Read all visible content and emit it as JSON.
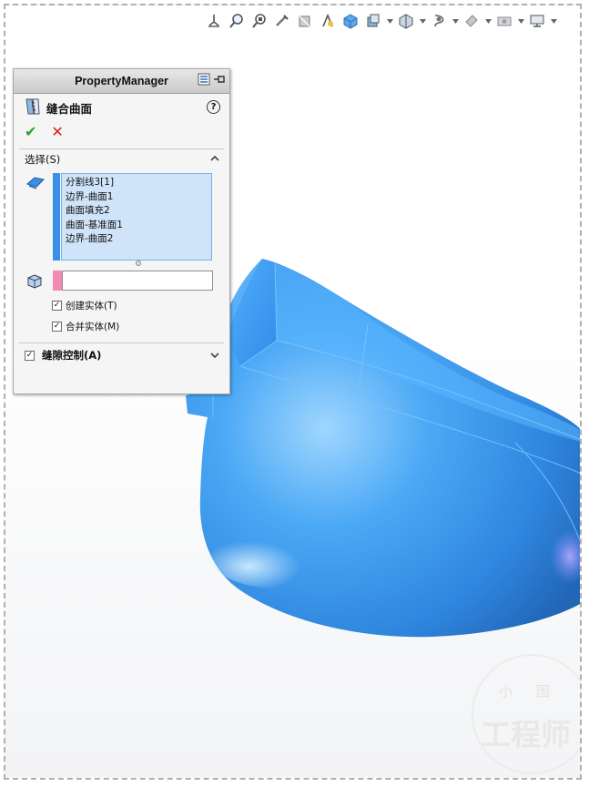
{
  "toolbar": {
    "icons": [
      "view-orientation-icon",
      "zoom-to-fit-icon",
      "zoom-area-icon",
      "previous-view-icon",
      "section-view-icon",
      "dynamic-annotation-icon",
      "view-orientation-cube-icon",
      "display-style-icon",
      "hide-show-icon",
      "edit-appearance-icon",
      "apply-scene-icon",
      "view-settings-icon",
      "monitor-icon"
    ]
  },
  "property_manager": {
    "header": "PropertyManager",
    "feature_title": "缝合曲面",
    "help": "?",
    "ok": "✔",
    "cancel": "✕",
    "selection_group": {
      "label": "选择(S)",
      "items": [
        "分割线3[1]",
        "边界-曲面1",
        "曲面填充2",
        "曲面-基准面1",
        "边界-曲面2"
      ]
    },
    "body_input_value": "",
    "options": [
      {
        "label": "创建实体(T)",
        "checked": true
      },
      {
        "label": "合并实体(M)",
        "checked": true
      }
    ],
    "gap_control": {
      "label": "缝隙控制(A)",
      "checked": true
    }
  },
  "watermark": {
    "top": "小国",
    "main": "工程师"
  },
  "colors": {
    "accent_blue": "#3b8fe6",
    "selection_bg": "#cfe4f8",
    "body_color_bar": "#f28bb4",
    "model_blue": "#3f9af0"
  }
}
